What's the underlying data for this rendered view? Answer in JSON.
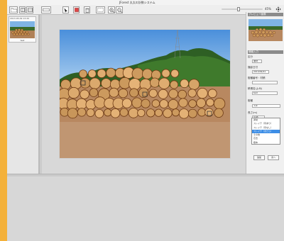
{
  "window": {
    "title": "JForest 丸太の計数システム"
  },
  "toolbar": {
    "buttons": [
      {
        "name": "open-folder-button",
        "icon": "folder-icon"
      },
      {
        "name": "thumbnails-button",
        "icon": "thumbnails-icon"
      },
      {
        "name": "split-view-button",
        "icon": "split-view-icon"
      },
      {
        "name": "line-tool-button",
        "icon": "line-icon"
      },
      {
        "name": "pointer-tool-button",
        "icon": "pointer-icon"
      },
      {
        "name": "stop-button",
        "icon": "stop-icon"
      },
      {
        "name": "delete-button",
        "icon": "trash-icon"
      },
      {
        "name": "select-rect-button",
        "icon": "rectangle-select-icon"
      },
      {
        "name": "zoom-in-button",
        "icon": "zoom-in-icon"
      },
      {
        "name": "zoom-out-button",
        "icon": "zoom-out-icon"
      }
    ],
    "zoom_label": "45%",
    "zoom_level": 0.4
  },
  "thumbnails": [
    {
      "caption": "2013-05-09 13:20",
      "name": "test"
    }
  ],
  "right_panel": {
    "preview_header": "プレビュー画像",
    "info_header": "情報入力",
    "kind_label": "区分",
    "kind_value": "素材",
    "date_label": "撮影日付",
    "date_value": "2013/09/21",
    "species_label": "樹種番号・材積",
    "species_value": "",
    "pile_label": "積場名(よみ)",
    "pile_value": "test",
    "tree_label": "樹種",
    "tree_value": "スギ",
    "length_label": "長さ(m)",
    "length_value": "3.65",
    "options": [
      "通常",
      "スレイテ（帯あり）",
      "スレイテ（帯なし）",
      "スレイテ（まだら）",
      "その他",
      "芯去",
      "根本"
    ],
    "selected_index": 3,
    "ok_label": "追加",
    "next_label": "次へ"
  },
  "colors": {
    "accent": "#f4b13a",
    "selection": "#3d8ee6"
  }
}
